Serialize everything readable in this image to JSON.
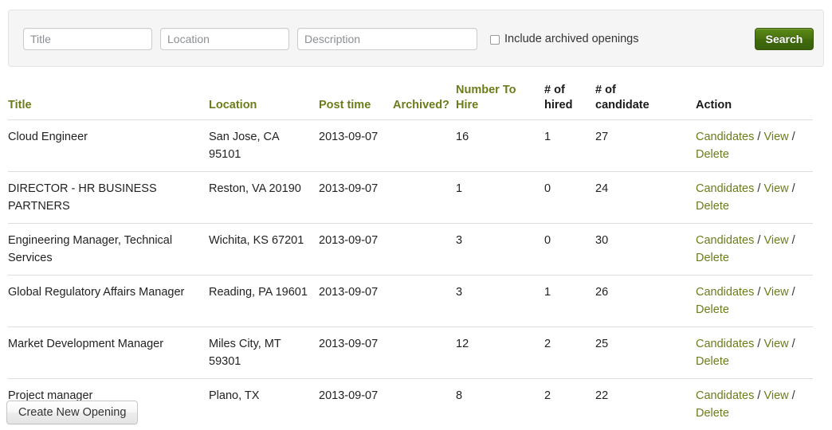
{
  "search_panel": {
    "title_placeholder": "Title",
    "location_placeholder": "Location",
    "description_placeholder": "Description",
    "title_value": "",
    "location_value": "",
    "description_value": "",
    "archived_checkbox_label": "Include archived openings",
    "archived_checkbox_checked": false,
    "search_button_label": "Search",
    "search_button_color": "#4a7510"
  },
  "table": {
    "headers": {
      "title": "Title",
      "location": "Location",
      "post_time": "Post time",
      "archived": "Archived?",
      "number_to_hire_line1": "Number To",
      "number_to_hire_line2": "Hire",
      "num_hired_line1": "# of",
      "num_hired_line2": "hired",
      "num_candidate_line1": "# of",
      "num_candidate_line2": "candidate",
      "action": "Action"
    },
    "header_link_color": "#6b7d1a",
    "rows": [
      {
        "title": "Cloud Engineer",
        "location": "San Jose, CA 95101",
        "post_time": "2013-09-07",
        "archived": "",
        "number_to_hire": "16",
        "num_hired": "1",
        "num_candidate": "27"
      },
      {
        "title": "DIRECTOR - HR BUSINESS PARTNERS",
        "location": "Reston, VA 20190",
        "post_time": "2013-09-07",
        "archived": "",
        "number_to_hire": "1",
        "num_hired": "0",
        "num_candidate": "24"
      },
      {
        "title": "Engineering Manager, Technical Services",
        "location": "Wichita, KS 67201",
        "post_time": "2013-09-07",
        "archived": "",
        "number_to_hire": "3",
        "num_hired": "0",
        "num_candidate": "30"
      },
      {
        "title": "Global Regulatory Affairs Manager",
        "location": "Reading, PA 19601",
        "post_time": "2013-09-07",
        "archived": "",
        "number_to_hire": "3",
        "num_hired": "1",
        "num_candidate": "26"
      },
      {
        "title": "Market Development Manager",
        "location": "Miles City, MT 59301",
        "post_time": "2013-09-07",
        "archived": "",
        "number_to_hire": "12",
        "num_hired": "2",
        "num_candidate": "25"
      },
      {
        "title": "Project manager",
        "location": "Plano, TX",
        "post_time": "2013-09-07",
        "archived": "",
        "number_to_hire": "8",
        "num_hired": "2",
        "num_candidate": "22"
      }
    ],
    "action_links": {
      "candidates": "Candidates",
      "view": "View",
      "delete": "Delete",
      "separator": "/",
      "link_color": "#6b7d1a"
    }
  },
  "footer": {
    "create_button_label": "Create New Opening"
  }
}
